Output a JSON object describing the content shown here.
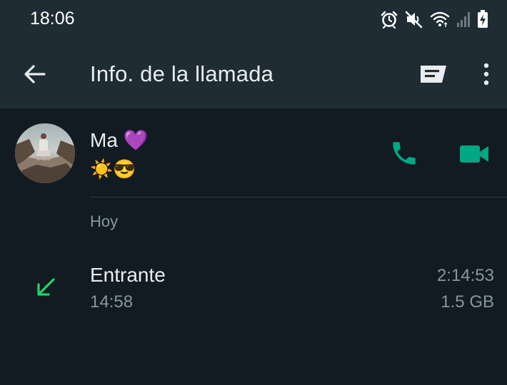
{
  "status_bar": {
    "time": "18:06",
    "icons": [
      "alarm-icon",
      "mute-icon",
      "wifi-icon",
      "signal-icon",
      "battery-charging-icon"
    ]
  },
  "app_bar": {
    "title": "Info. de la llamada",
    "back_icon": "arrow-left-icon",
    "actions": [
      "message-icon",
      "more-vert-icon"
    ]
  },
  "contact": {
    "name": "Ma 💜",
    "status": "☀️😎",
    "actions": [
      "voice-call-icon",
      "video-call-icon"
    ]
  },
  "section": {
    "label": "Hoy"
  },
  "call": {
    "type": "Entrante",
    "time": "14:58",
    "duration": "2:14:53",
    "size": "1.5 GB",
    "direction_icon": "incoming-arrow-icon"
  },
  "colors": {
    "background": "#121b22",
    "header": "#1f2c34",
    "accent": "#00a884",
    "incoming": "#25d366",
    "secondary_text": "#8696a0"
  }
}
